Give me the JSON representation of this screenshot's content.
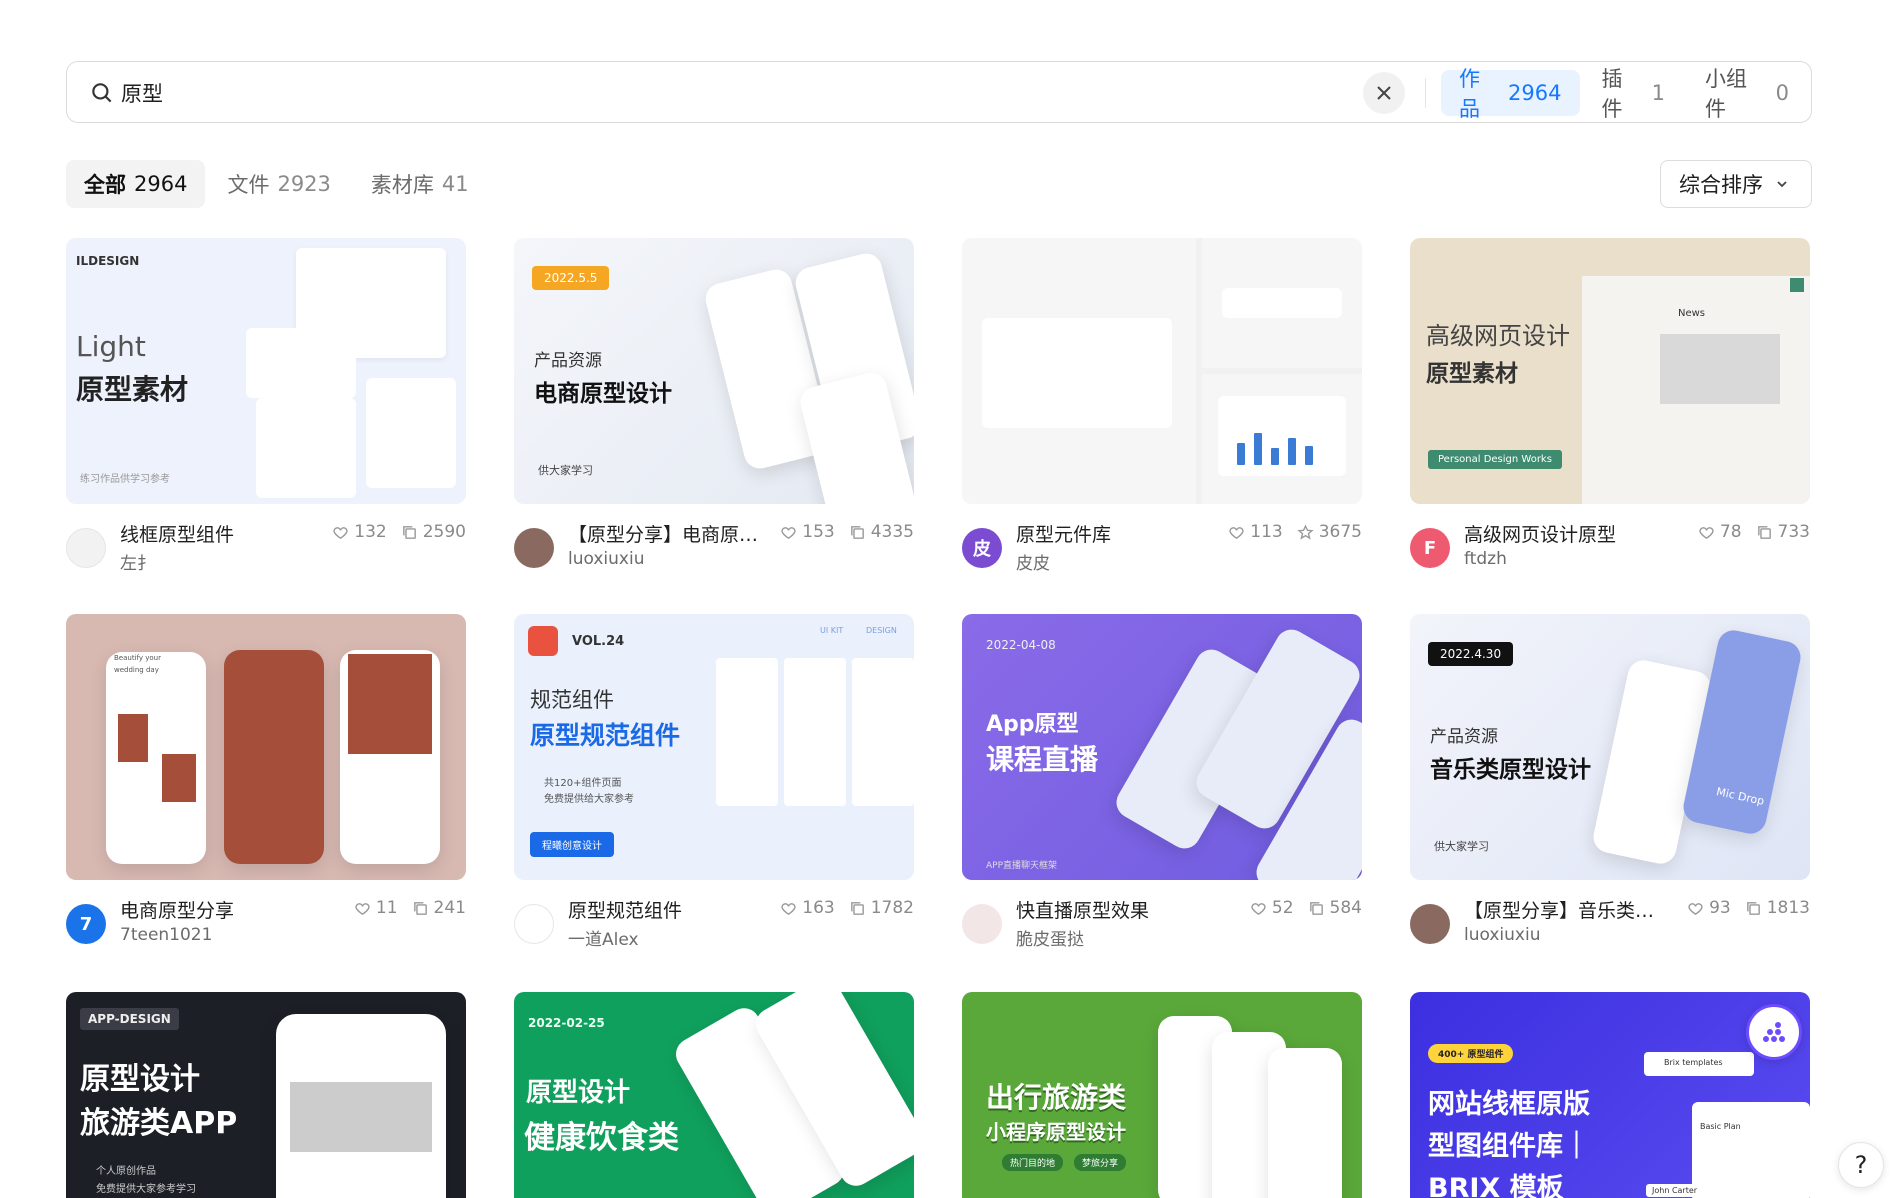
{
  "search": {
    "value": "原型",
    "scopes": [
      {
        "label": "作品",
        "count": "2964"
      },
      {
        "label": "插件",
        "count": "1"
      },
      {
        "label": "小组件",
        "count": "0"
      }
    ]
  },
  "filters": [
    {
      "label": "全部",
      "count": "2964"
    },
    {
      "label": "文件",
      "count": "2923"
    },
    {
      "label": "素材库",
      "count": "41"
    }
  ],
  "sort": {
    "label": "综合排序"
  },
  "cards": [
    {
      "title": "线框原型组件",
      "author": "左扌",
      "likes": "132",
      "dupes": "2590",
      "thumb": {
        "brand": "ILDESIGN",
        "line1": "Light",
        "line2": "原型素材",
        "foot": "练习作品供学习参考"
      }
    },
    {
      "title": "【原型分享】电商原型设计",
      "author": "luoxiuxiu",
      "likes": "153",
      "dupes": "4335",
      "thumb": {
        "tag": "2022.5.5",
        "line1": "产品资源",
        "line2": "电商原型设计",
        "foot": "供大家学习"
      }
    },
    {
      "title": "原型元件库",
      "author": "皮皮",
      "likes": "113",
      "stars": "3675",
      "avatar_text": "皮"
    },
    {
      "title": "高级网页设计原型",
      "author": "ftdzh",
      "likes": "78",
      "dupes": "733",
      "avatar_text": "F",
      "thumb": {
        "line1": "高级网页设计",
        "line2": "原型素材",
        "badge": "Personal Design Works",
        "news": "News"
      }
    },
    {
      "title": "电商原型分享",
      "author": "7teen1021",
      "likes": "11",
      "dupes": "241",
      "avatar_text": "7",
      "thumb": {
        "line1": "Beautify your",
        "line2": "wedding day"
      }
    },
    {
      "title": "原型规范组件",
      "author": "一道Alex",
      "likes": "163",
      "dupes": "1782",
      "thumb": {
        "vol": "VOL.24",
        "kit": "UI KIT",
        "design": "DESIGN",
        "line1": "规范组件",
        "line2": "原型规范组件",
        "b1": "共120+组件页面",
        "b2": "免费提供给大家参考",
        "btn": "程曦创意设计"
      }
    },
    {
      "title": "快直播原型效果",
      "author": "脆皮蛋挞",
      "likes": "52",
      "dupes": "584",
      "thumb": {
        "date": "2022-04-08",
        "line1": "App原型",
        "line2": "课程直播",
        "foot": "APP直播聊天框架"
      }
    },
    {
      "title": "【原型分享】音乐类原型设计",
      "author": "luoxiuxiu",
      "likes": "93",
      "dupes": "1813",
      "thumb": {
        "tag": "2022.4.30",
        "line1": "产品资源",
        "line2": "音乐类原型设计",
        "foot": "供大家学习",
        "extra": "Mic Drop"
      }
    },
    {
      "title": "",
      "author": "",
      "thumb": {
        "tag": "APP-DESIGN",
        "line1": "原型设计",
        "line2": "旅游类APP",
        "b1": "个人原创作品",
        "b2": "免费提供大家参考学习"
      }
    },
    {
      "title": "",
      "author": "",
      "thumb": {
        "date": "2022-02-25",
        "line1": "原型设计",
        "line2": "健康饮食类"
      }
    },
    {
      "title": "",
      "author": "",
      "thumb": {
        "line1": "出行旅游类",
        "line2": "小程序原型设计",
        "b1": "热门目的地",
        "b2": "梦旅分享"
      }
    },
    {
      "title": "",
      "author": "",
      "thumb": {
        "tag": "400+ 原型组件",
        "line1": "网站线框原版",
        "line2": "型图组件库｜",
        "line3": "BRIX 模板",
        "extra": "Brix templates",
        "plan": "Basic Plan",
        "name": "John Carter"
      }
    }
  ],
  "colors": {
    "accent": "#1677ff",
    "purple": "#6d4bff"
  }
}
